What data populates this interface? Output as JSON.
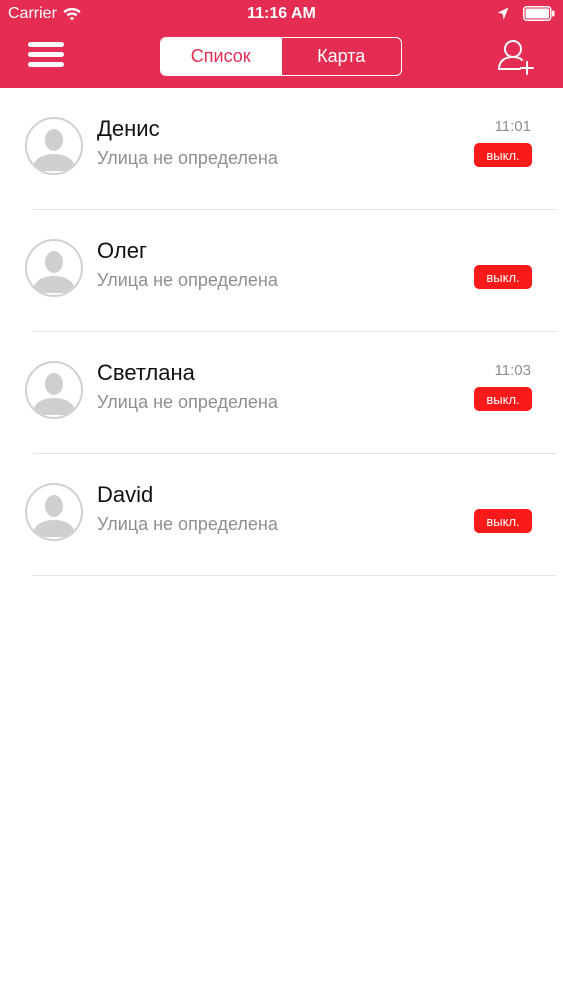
{
  "status_bar": {
    "carrier": "Carrier",
    "time": "11:16 AM"
  },
  "nav": {
    "segments": [
      "Список",
      "Карта"
    ],
    "active_segment": "Список"
  },
  "colors": {
    "brand": "#e52c52",
    "badge": "#fa1a1a",
    "secondary_text": "#8e8e93"
  },
  "contacts": [
    {
      "name": "Денис",
      "street": "Улица не определена",
      "time": "11:01",
      "status": "выкл."
    },
    {
      "name": "Олег",
      "street": "Улица не определена",
      "time": "",
      "status": "выкл."
    },
    {
      "name": "Светлана",
      "street": "Улица не определена",
      "time": "11:03",
      "status": "выкл."
    },
    {
      "name": "David",
      "street": "Улица не определена",
      "time": "",
      "status": "выкл."
    }
  ],
  "icons": {
    "menu": "hamburger-icon",
    "add_user": "add-user-icon",
    "avatar": "person-placeholder-icon"
  }
}
